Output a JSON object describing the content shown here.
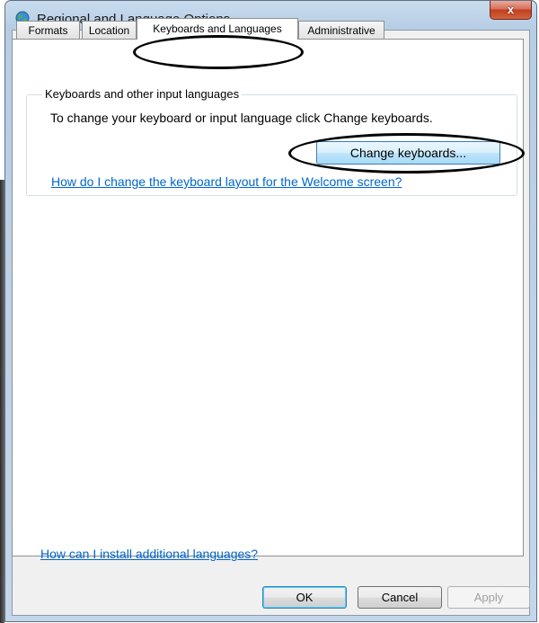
{
  "window": {
    "title": "Regional and Language Options",
    "close_label": "x"
  },
  "tabs": [
    {
      "label": "Formats",
      "selected": false
    },
    {
      "label": "Location",
      "selected": false
    },
    {
      "label": "Keyboards and Languages",
      "selected": true
    },
    {
      "label": "Administrative",
      "selected": false
    }
  ],
  "keyboards_group": {
    "title": "Keyboards and other input languages",
    "description": "To change your keyboard or input language click Change keyboards.",
    "change_button_label": "Change keyboards...",
    "welcome_link": "How do I change the keyboard layout for the Welcome screen?"
  },
  "install_link": "How can I install additional languages?",
  "buttons": {
    "ok": "OK",
    "cancel": "Cancel",
    "apply": "Apply"
  },
  "colors": {
    "link": "#0066cc",
    "close_button": "#c1401f",
    "frame": "#b7cde4"
  }
}
